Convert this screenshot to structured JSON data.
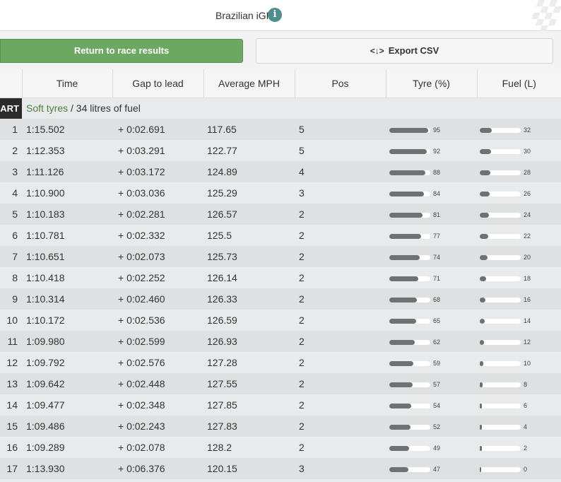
{
  "header": {
    "title": "Brazilian iGP",
    "info_icon": "i"
  },
  "buttons": {
    "return_label": "Return to race results",
    "export_label": "Export CSV",
    "export_icon": "<↓>"
  },
  "columns": {
    "lap": "",
    "time": "Time",
    "gap": "Gap to lead",
    "mph": "Average MPH",
    "pos": "Pos",
    "tyre": "Tyre (%)",
    "fuel": "Fuel (L)"
  },
  "start": {
    "label": "ART",
    "tyre_text": "Soft tyres",
    "rest_text": " / 34 litres of fuel"
  },
  "colors": {
    "accent_green": "#6da861",
    "info_teal": "#4f8d8f",
    "bar_fill": "#6f7274"
  },
  "rows": [
    {
      "lap": "1",
      "time": "1:15.502",
      "gap": "+ 0:02.691",
      "mph": "117.65",
      "pos": "5",
      "tyre": 95,
      "fuel": 32
    },
    {
      "lap": "2",
      "time": "1:12.353",
      "gap": "+ 0:03.291",
      "mph": "122.77",
      "pos": "5",
      "tyre": 92,
      "fuel": 30
    },
    {
      "lap": "3",
      "time": "1:11.126",
      "gap": "+ 0:03.172",
      "mph": "124.89",
      "pos": "4",
      "tyre": 88,
      "fuel": 28
    },
    {
      "lap": "4",
      "time": "1:10.900",
      "gap": "+ 0:03.036",
      "mph": "125.29",
      "pos": "3",
      "tyre": 84,
      "fuel": 26
    },
    {
      "lap": "5",
      "time": "1:10.183",
      "gap": "+ 0:02.281",
      "mph": "126.57",
      "pos": "2",
      "tyre": 81,
      "fuel": 24
    },
    {
      "lap": "6",
      "time": "1:10.781",
      "gap": "+ 0:02.332",
      "mph": "125.5",
      "pos": "2",
      "tyre": 77,
      "fuel": 22
    },
    {
      "lap": "7",
      "time": "1:10.651",
      "gap": "+ 0:02.073",
      "mph": "125.73",
      "pos": "2",
      "tyre": 74,
      "fuel": 20
    },
    {
      "lap": "8",
      "time": "1:10.418",
      "gap": "+ 0:02.252",
      "mph": "126.14",
      "pos": "2",
      "tyre": 71,
      "fuel": 18
    },
    {
      "lap": "9",
      "time": "1:10.314",
      "gap": "+ 0:02.460",
      "mph": "126.33",
      "pos": "2",
      "tyre": 68,
      "fuel": 16
    },
    {
      "lap": "10",
      "time": "1:10.172",
      "gap": "+ 0:02.536",
      "mph": "126.59",
      "pos": "2",
      "tyre": 65,
      "fuel": 14
    },
    {
      "lap": "11",
      "time": "1:09.980",
      "gap": "+ 0:02.599",
      "mph": "126.93",
      "pos": "2",
      "tyre": 62,
      "fuel": 12
    },
    {
      "lap": "12",
      "time": "1:09.792",
      "gap": "+ 0:02.576",
      "mph": "127.28",
      "pos": "2",
      "tyre": 59,
      "fuel": 10
    },
    {
      "lap": "13",
      "time": "1:09.642",
      "gap": "+ 0:02.448",
      "mph": "127.55",
      "pos": "2",
      "tyre": 57,
      "fuel": 8
    },
    {
      "lap": "14",
      "time": "1:09.477",
      "gap": "+ 0:02.348",
      "mph": "127.85",
      "pos": "2",
      "tyre": 54,
      "fuel": 6
    },
    {
      "lap": "15",
      "time": "1:09.486",
      "gap": "+ 0:02.243",
      "mph": "127.83",
      "pos": "2",
      "tyre": 52,
      "fuel": 4
    },
    {
      "lap": "16",
      "time": "1:09.289",
      "gap": "+ 0:02.078",
      "mph": "128.2",
      "pos": "2",
      "tyre": 49,
      "fuel": 2
    },
    {
      "lap": "17",
      "time": "1:13.930",
      "gap": "+ 0:06.376",
      "mph": "120.15",
      "pos": "3",
      "tyre": 47,
      "fuel": 0
    }
  ]
}
